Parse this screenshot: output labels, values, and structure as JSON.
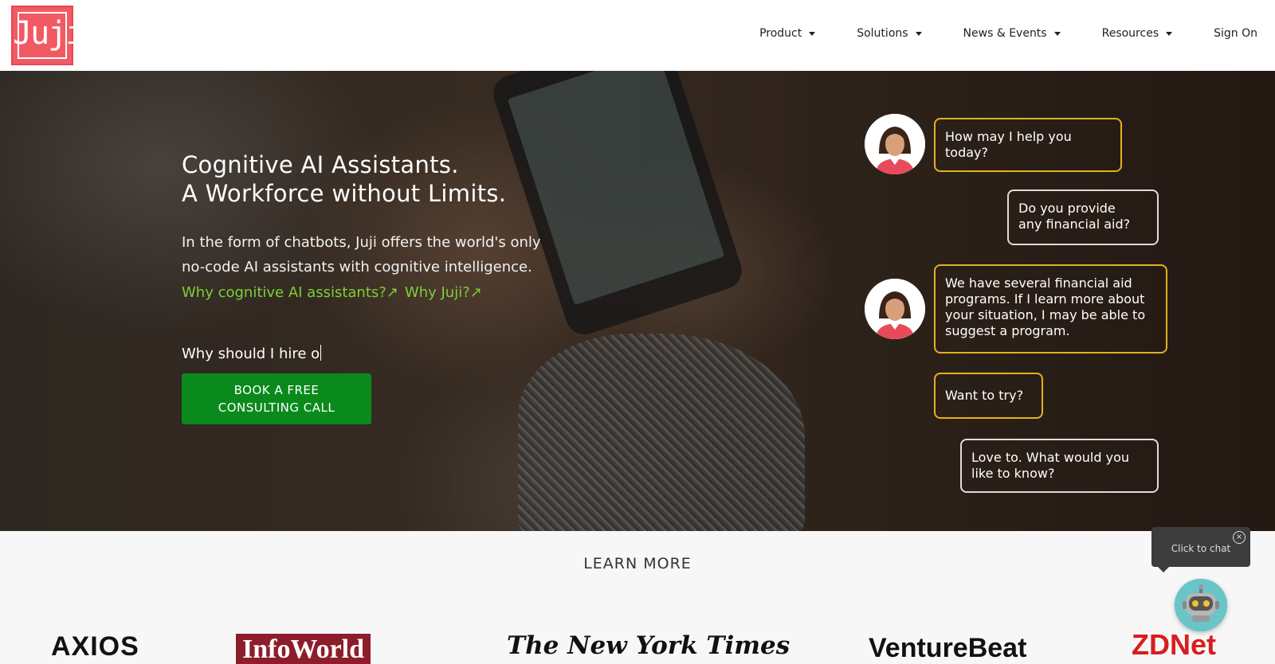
{
  "brand": {
    "logo_text": "Juji",
    "logo_color": "#f25a63"
  },
  "nav": {
    "items": [
      {
        "label": "Product",
        "dropdown": true
      },
      {
        "label": "Solutions",
        "dropdown": true
      },
      {
        "label": "News & Events",
        "dropdown": true
      },
      {
        "label": "Resources",
        "dropdown": true
      },
      {
        "label": "Sign On",
        "dropdown": false
      }
    ]
  },
  "hero": {
    "title_line1": "Cognitive AI Assistants.",
    "title_line2": "A Workforce without Limits.",
    "subtitle_line1": "In the form of chatbots, Juji offers the world's only",
    "subtitle_line2": "no-code AI assistants with cognitive intelligence.",
    "link1": "Why cognitive AI assistants?↗",
    "link2": "Why Juji?↗",
    "typing_text": "Why should I hire o",
    "cta_line1": "BOOK A FREE",
    "cta_line2": "CONSULTING CALL",
    "cta_color": "#0a8a1c",
    "link_color": "#7ccf38"
  },
  "chat": {
    "messages": [
      {
        "from": "bot",
        "line1": "How may I help you",
        "line2": "today?"
      },
      {
        "from": "user",
        "line1": "Do you provide",
        "line2": "any financial aid?"
      },
      {
        "from": "bot",
        "line1": "We have several financial aid",
        "line2": "programs. If I learn more about",
        "line3": "your situation, I may be able to",
        "line4": "suggest a program."
      },
      {
        "from": "bot",
        "line1": "Want to try?"
      },
      {
        "from": "user",
        "line1": "Love to. What would you",
        "line2": "like to know?"
      }
    ],
    "bot_border_color": "#e1b21e"
  },
  "learn_more": {
    "title": "LEARN MORE",
    "publications": [
      "AXIOS",
      "InfoWorld",
      "The New York Times",
      "VentureBeat",
      "ZDNet"
    ]
  },
  "chat_widget": {
    "tooltip": "Click to chat",
    "icon": "robot-icon"
  }
}
